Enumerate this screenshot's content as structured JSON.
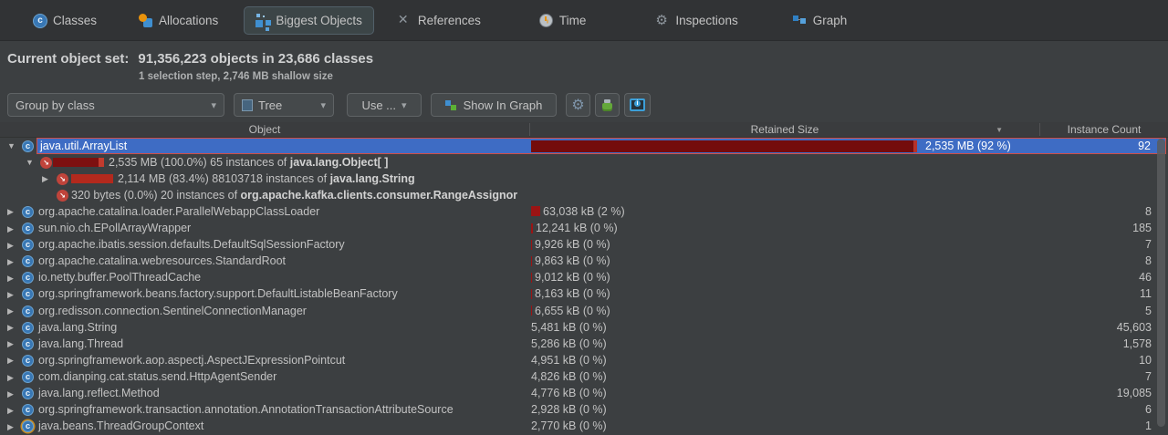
{
  "colors": {
    "selection_blue": "#3e6cc4",
    "selection_border_red": "#cf4f47",
    "bar_dark_red": "#740c0c",
    "bar_bright_red": "#b5322a",
    "class_icon_blue": "#3877b4",
    "ref_icon_red": "#c0443b",
    "panel_bg": "#3c3f41",
    "tabbar_bg": "#313335"
  },
  "icons": {
    "chevron_down": "▾",
    "sort_desc": "▼",
    "expander_open": "▼",
    "expander_closed": "▶",
    "class_letter": "c",
    "ref_arrow": "↘",
    "gear_ring": "⚙"
  },
  "tabs": [
    {
      "label": "Classes",
      "icon": "classes-icon",
      "selected": false
    },
    {
      "label": "Allocations",
      "icon": "allocations-icon",
      "selected": false
    },
    {
      "label": "Biggest Objects",
      "icon": "biggest-objects-icon",
      "selected": true
    },
    {
      "label": "References",
      "icon": "references-icon",
      "selected": false
    },
    {
      "label": "Time",
      "icon": "time-icon",
      "selected": false
    },
    {
      "label": "Inspections",
      "icon": "inspections-icon",
      "selected": false
    },
    {
      "label": "Graph",
      "icon": "graph-icon",
      "selected": false
    }
  ],
  "summary": {
    "label": "Current object set:",
    "value": "91,356,223 objects in 23,686 classes",
    "detail": "1 selection step, 2,746 MB shallow size"
  },
  "toolbar": {
    "group_by": "Group by class",
    "view_mode": "Tree",
    "use_button": "Use ...",
    "show_in_graph": "Show In Graph"
  },
  "table": {
    "columns": {
      "object": "Object",
      "retained": "Retained Size",
      "instances": "Instance Count"
    },
    "selected": {
      "name": "java.util.ArrayList",
      "retained": "2,535 MB (92 %)",
      "retained_pct": 92,
      "count": "92"
    },
    "children": [
      {
        "level": 1,
        "expander": "open",
        "pct": 100,
        "bar": "dark",
        "prefix": "2,535 MB (100.0%) 65 instances of ",
        "class_name": "java.lang.Object[ ]"
      },
      {
        "level": 2,
        "expander": "closed",
        "pct": 83.4,
        "bar": "bright",
        "prefix": "2,114 MB (83.4%) 88103718 instances of ",
        "class_name": "java.lang.String"
      },
      {
        "level": 2,
        "expander": "none",
        "pct": 0,
        "bar": "none",
        "prefix": "320 bytes (0.0%) 20 instances of ",
        "class_name": "org.apache.kafka.clients.consumer.RangeAssignor"
      }
    ],
    "rows": [
      {
        "name": "org.apache.catalina.loader.ParallelWebappClassLoader",
        "retained": "63,038 kB (2 %)",
        "pct": 2.3,
        "count": "8",
        "ring": false
      },
      {
        "name": "sun.nio.ch.EPollArrayWrapper",
        "retained": "12,241 kB (0 %)",
        "pct": 0.446,
        "count": "185",
        "ring": false
      },
      {
        "name": "org.apache.ibatis.session.defaults.DefaultSqlSessionFactory",
        "retained": "9,926 kB (0 %)",
        "pct": 0.362,
        "count": "7",
        "ring": false
      },
      {
        "name": "org.apache.catalina.webresources.StandardRoot",
        "retained": "9,863 kB (0 %)",
        "pct": 0.359,
        "count": "8",
        "ring": false
      },
      {
        "name": "io.netty.buffer.PoolThreadCache",
        "retained": "9,012 kB (0 %)",
        "pct": 0.328,
        "count": "46",
        "ring": false
      },
      {
        "name": "org.springframework.beans.factory.support.DefaultListableBeanFactory",
        "retained": "8,163 kB (0 %)",
        "pct": 0.297,
        "count": "11",
        "ring": false
      },
      {
        "name": "org.redisson.connection.SentinelConnectionManager",
        "retained": "6,655 kB (0 %)",
        "pct": 0.242,
        "count": "5",
        "ring": false
      },
      {
        "name": "java.lang.String",
        "retained": "5,481 kB (0 %)",
        "pct": 0.199,
        "count": "45,603",
        "ring": false
      },
      {
        "name": "java.lang.Thread",
        "retained": "5,286 kB (0 %)",
        "pct": 0.192,
        "count": "1,578",
        "ring": false
      },
      {
        "name": "org.springframework.aop.aspectj.AspectJExpressionPointcut",
        "retained": "4,951 kB (0 %)",
        "pct": 0.18,
        "count": "10",
        "ring": false
      },
      {
        "name": "com.dianping.cat.status.send.HttpAgentSender",
        "retained": "4,826 kB (0 %)",
        "pct": 0.176,
        "count": "7",
        "ring": false
      },
      {
        "name": "java.lang.reflect.Method",
        "retained": "4,776 kB (0 %)",
        "pct": 0.174,
        "count": "19,085",
        "ring": false
      },
      {
        "name": "org.springframework.transaction.annotation.AnnotationTransactionAttributeSource",
        "retained": "2,928 kB (0 %)",
        "pct": 0.107,
        "count": "6",
        "ring": false
      },
      {
        "name": "java.beans.ThreadGroupContext",
        "retained": "2,770 kB (0 %)",
        "pct": 0.101,
        "count": "1",
        "ring": true
      }
    ]
  }
}
